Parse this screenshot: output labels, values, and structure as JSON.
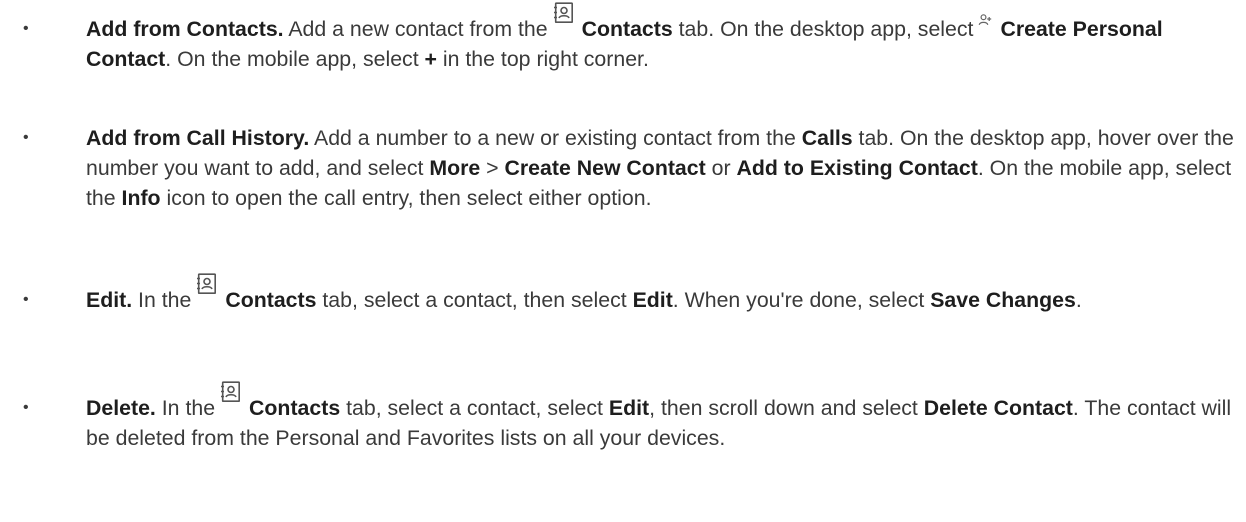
{
  "items": [
    {
      "heading": "Add from Contacts.",
      "t1": " Add a new contact from the",
      "icon": "contacts-book-icon",
      "b1": "Contacts",
      "t2": " tab. On the desktop app, select",
      "icon2": "add-person-icon",
      "b2": "Create Personal Contact",
      "t3": ". On the mobile app, select ",
      "b3": "+",
      "t4": " in the top right corner."
    },
    {
      "heading": "Add from Call History.",
      "t1": " Add a number to a new or existing contact from the ",
      "b1": "Calls",
      "t2": " tab. On the desktop app, hover over the number you want to add, and select ",
      "b2": "More",
      "t3": " > ",
      "b3": "Create New Contact",
      "t4": " or ",
      "b4": "Add to Existing Contact",
      "t5": ". On the mobile app, select the ",
      "b5": "Info",
      "t6": " icon to open the call entry, then select either option."
    },
    {
      "heading": "Edit.",
      "t1": " In the",
      "icon": "contacts-book-icon",
      "b1": "Contacts",
      "t2": " tab, select a contact, then select ",
      "b2": "Edit",
      "t3": ". When you're done, select ",
      "b3": "Save Changes",
      "t4": "."
    },
    {
      "heading": "Delete.",
      "t1": " In the",
      "icon": "contacts-book-icon",
      "b1": "Contacts",
      "t2": " tab, select a contact, select ",
      "b2": "Edit",
      "t3": ", then scroll down and select ",
      "b3": "Delete Contact",
      "t4": ". The contact will be deleted from the Personal and Favorites lists on all your devices."
    }
  ]
}
